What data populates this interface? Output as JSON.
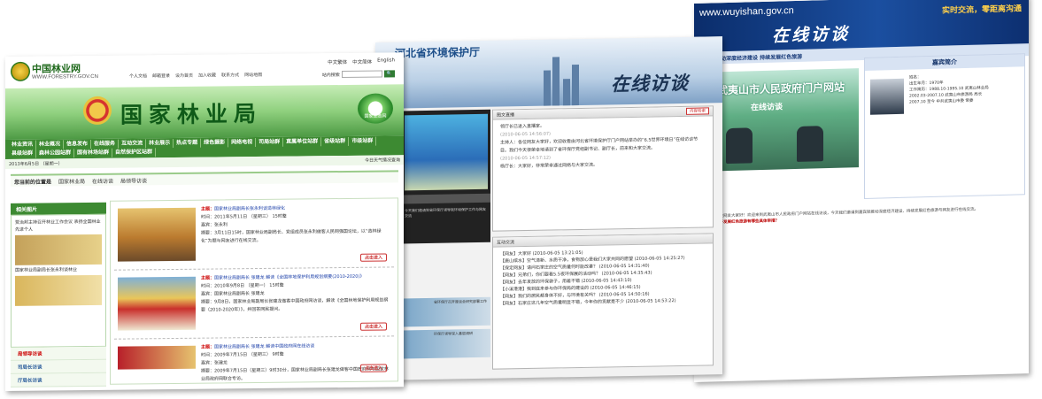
{
  "s3": {
    "url": "www.wuyishan.gov.cn",
    "title": "在线访谈",
    "slogan": "实时交流，零距离沟通",
    "sub_left": "嘉宾：推动深度经济建设 持续发展红色旅游",
    "sub_right": "嘉宾简介",
    "photo_caption": "武夷山市人民政府门户网站",
    "photo_caption2": "在线访谈",
    "guest_head": "嘉宾简介",
    "guest_text": "姓名：\n出生年月：1970年\n工作简历：1988.10-1995.10 武夷山林业局\n2002.03-2007.10 武夷山市旅游局 局长\n2007.10 至今 中共武夷山市委 常委",
    "body_text": "主持人：各位网友大家好！欢迎来到武夷山市人民政府门户网站在线访谈，今天我们邀请到嘉宾就推动深度经济建设、持续发展红色旅游与网友进行在线交流。",
    "body_q": "【网友】关于发展红色旅游有哪些具体举措？"
  },
  "s2": {
    "title": "河北省环境保护厅",
    "title2": "在线访谈",
    "video_text": "今天我们邀请到省环保厅领导就环境保护工作与网友交流",
    "list_label": "全屏",
    "p1_head": "图文直播",
    "p1_btn": "内容检索",
    "p1_lines": [
      "领厅长已进入直播室。",
      "(2010-06-05 14:56:07)",
      "主持人：各位网友大家好，欢迎收看由河北省环境保护厅门户网站举办的“6.5世界环境日”在线访谈节目。我们今天很荣幸地请到了省环保厅党组副书记、副厅长，前来和大家交流。",
      "(2010-06-05 14:57:12)",
      "杨厅长：大家好，非常荣幸通过网络与大家交流。"
    ],
    "p2_head": "互动交流",
    "p2_lines": [
      "【网友】大家好 (2010-06-05 13:21:05)",
      "【唐山缤水】空气清新、水质干净，食物放心是我们大家共同的愿望 (2010-06-05 14:25:27)",
      "【保定网友】请问石家庄的空气质量何时能改善？ (2010-06-05 14:31:40)",
      "【网友】兄弟们，你们要看5.5夜环保展的活动吗？ (2010-06-05 14:35:43)",
      "【网友】去年发放的环保袋子，用着不错 (2010-06-05 14:43:10)",
      "【小溪港港】我到底来参与你环保局的建设的 (2010-06-05 14:46:15)",
      "【网友】我们的居民都身体不好，与环境有关吗？ (2010-06-05 14:50:16)",
      "【网友】石家庄这几年空气质量明显不错，今年你的贡献是不少 (2010-06-05 14:53:22)"
    ],
    "thumb1": "省环保厅召开座谈会研究部署工作",
    "thumb2": "环保厅领导深入基层调研"
  },
  "s1": {
    "org_name": "中国林业网",
    "org_url": "WWW.FORESTRY.GOV.CN",
    "langs": [
      "中文繁体",
      "中文简体",
      "English"
    ],
    "links": [
      "个人文档",
      "邮箱登录",
      "设为首页",
      "加入收藏",
      "联系方式",
      "网站地图"
    ],
    "search_btn": "站内搜索",
    "hero_title": "国家林业局",
    "eco_label": "国家生态网",
    "nav": [
      "林业资讯",
      "林业概况",
      "信息发布",
      "在线服务",
      "互动交流",
      "林业展示",
      "热点专题",
      "绿色摄影",
      "网络电视",
      "司局站群",
      "直属单位站群",
      "省级站群",
      "市级站群",
      "县级站群",
      "森林公园站群",
      "国有林场站群",
      "自然保护区站群"
    ],
    "date": "2013年6月5日 （星期一）",
    "weather": "今日天气情况查询",
    "crumb_label": "您当前的位置是",
    "crumb": [
      "国家林业局",
      "在线访谈",
      "局领导访谈"
    ],
    "left_head": "相关图片",
    "left_text": "贾治邦主持召开林业工作会议 表扬全国林业先进个人",
    "left_text2": "国家林业局副局长张永利谈林业",
    "left_menus": [
      "局领导访谈",
      "司局长访谈",
      "厅局长访谈"
    ],
    "items": [
      {
        "subject": "主题：",
        "title": "国家林业局副局长张永利谈造林绿化",
        "time": "时间：2011年5月11日 （星期三） 15时整",
        "guest": "嘉宾：张永利",
        "summary": "摘要：3月11日15时，国家林业局副局长、党组成员张永利做客人民网强国论坛，以“造林绿化”为题与网友进行在线交流。",
        "more": "点击进入"
      },
      {
        "subject": "主题：",
        "title": "国家林业局副局长 张建龙 解读《全国林地保护利用规划纲要(2010-2020)》",
        "time": "时间：2010年9月8日 （星期一） 15时整",
        "guest": "嘉宾：国家林业局副局长 张建龙",
        "summary": "摘要：9月8日，国家林业局副局长张建龙做客中国政府网访谈，解读《全国林地保护利用规划纲要（2010-2020年）》，并回答网民提问。",
        "more": "点击进入"
      },
      {
        "subject": "主题：",
        "title": "国家林业局副局长 张建龙 解读中国政府网在线访谈",
        "time": "时间：2009年7月15日 （星期三） 9时整",
        "guest": "嘉宾：张建龙",
        "summary": "摘要：2009年7月15日（星期三）9时30分，国家林业局副局长张建龙做客中国政府网与国家林业局政府网联合专访。",
        "more": "点击进入"
      }
    ]
  }
}
